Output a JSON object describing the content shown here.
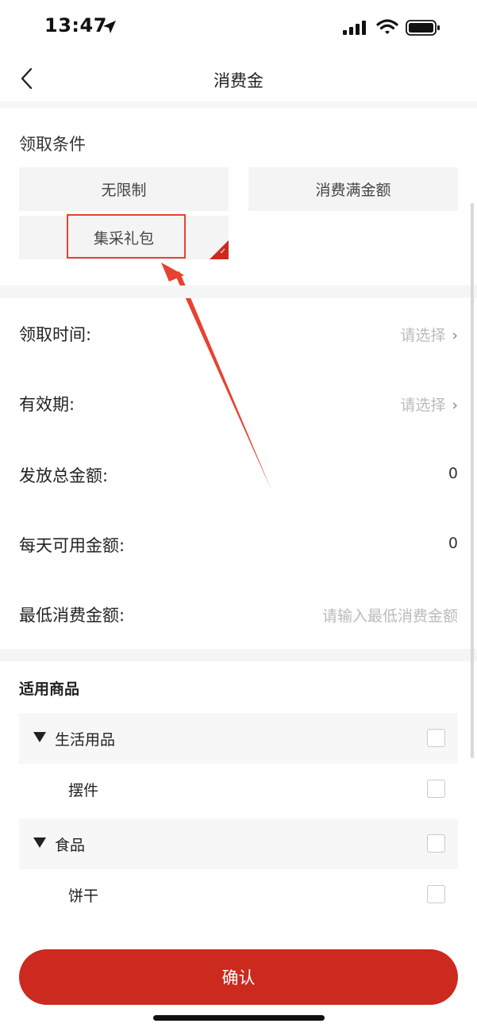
{
  "status_bar": {
    "time": "13:47"
  },
  "nav": {
    "title": "消费金"
  },
  "condition": {
    "title": "领取条件",
    "options": [
      "无限制",
      "消费满金额",
      "集采礼包"
    ],
    "selected": "集采礼包"
  },
  "form": {
    "claim_time": {
      "label": "领取时间:",
      "value": "请选择"
    },
    "validity": {
      "label": "有效期:",
      "value": "请选择"
    },
    "total_amount": {
      "label": "发放总金额:",
      "value": "0"
    },
    "daily_amount": {
      "label": "每天可用金额:",
      "value": "0"
    },
    "min_spend": {
      "label": "最低消费金额:",
      "placeholder": "请输入最低消费金额"
    }
  },
  "products": {
    "title": "适用商品",
    "items": [
      {
        "label": "生活用品",
        "type": "group"
      },
      {
        "label": "摆件",
        "type": "child"
      },
      {
        "label": "食品",
        "type": "group"
      },
      {
        "label": "饼干",
        "type": "child"
      }
    ]
  },
  "confirm_label": "确认",
  "colors": {
    "primary": "#cc2a1f",
    "annotation": "#e8412f"
  }
}
